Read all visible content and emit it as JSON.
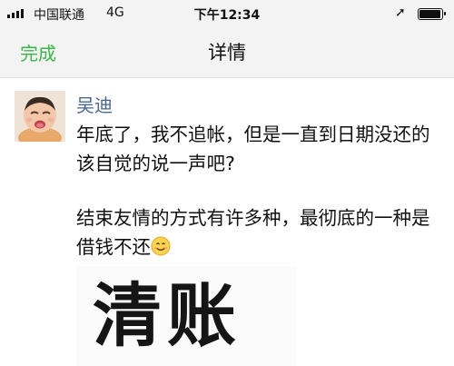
{
  "status_bar": {
    "carrier": "中国联通",
    "network": "4G",
    "time": "下午12:34",
    "location_icon": "location-arrow-icon",
    "battery_level": 0.88
  },
  "nav": {
    "done_label": "完成",
    "title": "详情",
    "accent_color": "#3bb54a"
  },
  "post": {
    "author": "吴迪",
    "author_color": "#4a6591",
    "paragraph1": "年底了，我不追帐，但是一直到日期没还的该自觉的说一声吧?",
    "paragraph2": "结束友情的方式有许多种，最彻底的一种是借钱不还",
    "emoji": "smile-emoji-icon",
    "image_text": "清账"
  }
}
